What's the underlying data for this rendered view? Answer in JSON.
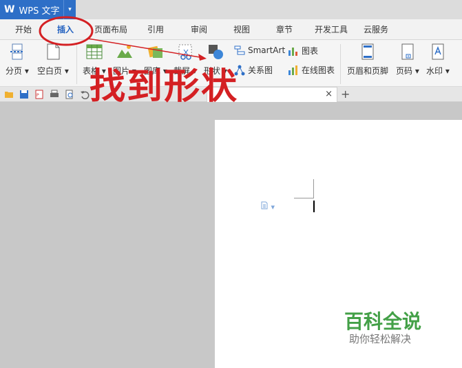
{
  "app": {
    "logo": "W",
    "title": "WPS 文字",
    "dropdown_glyph": "▾"
  },
  "menu": {
    "tabs": [
      {
        "label": "开始"
      },
      {
        "label": "插入"
      },
      {
        "label": "页面布局"
      },
      {
        "label": "引用"
      },
      {
        "label": "审阅"
      },
      {
        "label": "视图"
      },
      {
        "label": "章节"
      },
      {
        "label": "开发工具"
      },
      {
        "label": "云服务"
      }
    ],
    "active_tab": "插入"
  },
  "ribbon": {
    "page_break": "分页",
    "blank_page": "空白页",
    "table": "表格",
    "picture": "图片",
    "gallery": "图库",
    "screenshot": "截屏",
    "shapes": "形状",
    "smartart": "SmartArt",
    "chart": "图表",
    "relation_chart": "关系图",
    "online_chart": "在线图表",
    "header_footer": "页眉和页脚",
    "page_number": "页码",
    "watermark": "水印",
    "dropdown_glyph": "▾"
  },
  "doc_tabs": {
    "close_glyph": "×",
    "new_glyph": "+"
  },
  "annotation": {
    "text": "找到形状",
    "color": "#d42023"
  },
  "watermark": {
    "title": "百科全说",
    "subtitle": "助你轻松解决"
  },
  "colors": {
    "accent": "#2e6fc7",
    "active_tab": "#2462c0",
    "annotation": "#d42023",
    "watermark_green": "#43a047"
  }
}
